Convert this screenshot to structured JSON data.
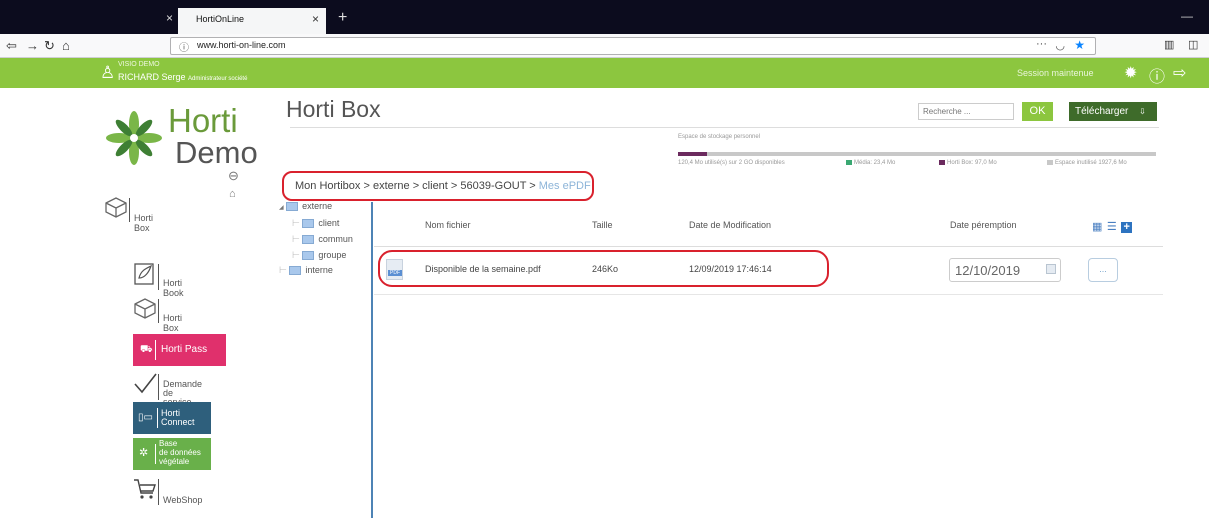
{
  "browser": {
    "tab_title": "HortiOnLine",
    "url": "www.horti-on-line.com",
    "close_glyph": "×",
    "new_tab_glyph": "+",
    "minimize_glyph": "—",
    "menu_dots": "···"
  },
  "appbar": {
    "user_line1": "VISIO DEMO",
    "user_line2": "RICHARD Serge",
    "user_role": "Administrateur société",
    "session_text": "Session maintenue",
    "color": "#8cc63f"
  },
  "logo": {
    "line1": "Horti",
    "line2": "Demo"
  },
  "sidebar": {
    "current": "Horti Box",
    "items": [
      {
        "label": "Horti Book"
      },
      {
        "label": "Horti Box"
      },
      {
        "label": "Horti Pass"
      },
      {
        "label": "Demande\nde service"
      },
      {
        "label": "Horti\nConnect"
      },
      {
        "label": "Base\nde données\nvégétale"
      },
      {
        "label": "WebShop"
      }
    ]
  },
  "main": {
    "title": "Horti Box",
    "search_placeholder": "Recherche ...",
    "ok_label": "OK",
    "download_label": "Télécharger",
    "download_glyph": "⇩"
  },
  "storage": {
    "title": "Espace de stockage personnel",
    "usage_text": "120,4 Mo utilisé(s) sur 2 GO disponibles",
    "used_fraction": 0.06,
    "legend": [
      {
        "label": "Média: 23,4 Mo",
        "color": "#3aa872"
      },
      {
        "label": "Horti Box: 97,0 Mo",
        "color": "#6b2a5e"
      },
      {
        "label": "Espace inutilisé 1927,6 Mo",
        "color": "#c8c8c8"
      }
    ]
  },
  "breadcrumb": {
    "path": "Mon Hortibox > externe > client > 56039-GOUT > ",
    "current": "Mes ePDF"
  },
  "tree": {
    "items": [
      {
        "label": "externe"
      },
      {
        "label": "client"
      },
      {
        "label": "commun"
      },
      {
        "label": "groupe"
      },
      {
        "label": "interne"
      }
    ]
  },
  "table": {
    "headers": {
      "name": "Nom fichier",
      "size": "Taille",
      "modified": "Date de Modification",
      "expiry": "Date péremption"
    },
    "rows": [
      {
        "icon_label": "PDF",
        "name": "Disponible de la semaine.pdf",
        "size": "246Ko",
        "modified": "12/09/2019 17:46:14",
        "expiry": "12/10/2019",
        "action": "..."
      }
    ]
  }
}
